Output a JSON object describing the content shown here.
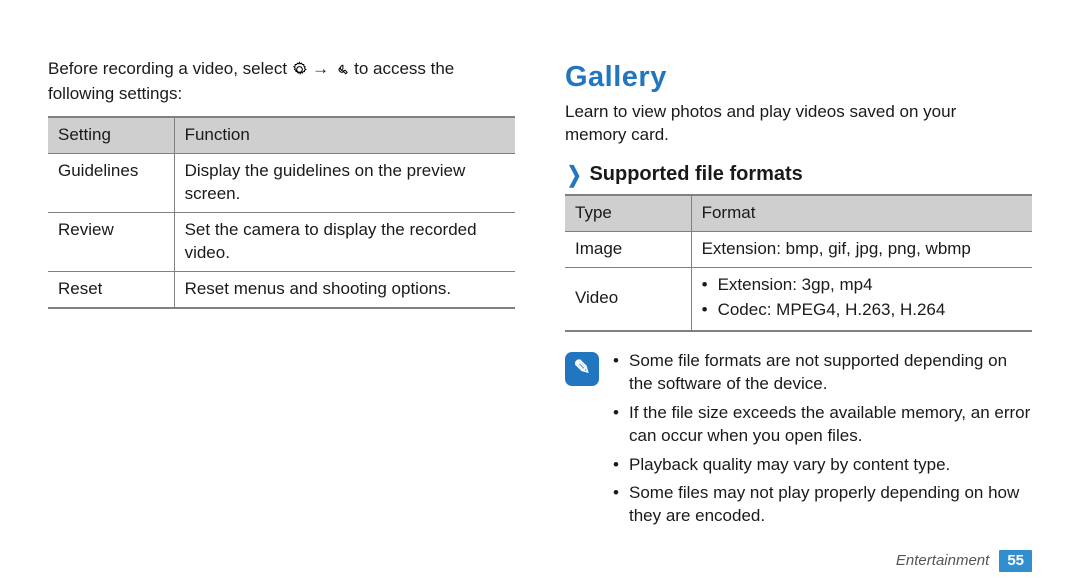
{
  "left": {
    "intro_1a": "Before recording a video, select",
    "intro_1b": "→",
    "intro_1c": "to access the",
    "intro_2": "following settings:",
    "icons": {
      "gear": "settings-gear",
      "wrench": "wrench-icon"
    },
    "table": {
      "head": {
        "c1": "Setting",
        "c2": "Function"
      },
      "rows": [
        {
          "c1": "Guidelines",
          "c2": "Display the guidelines on the preview screen."
        },
        {
          "c1": "Review",
          "c2": "Set the camera to display the recorded video."
        },
        {
          "c1": "Reset",
          "c2": "Reset menus and shooting options."
        }
      ]
    }
  },
  "right": {
    "title": "Gallery",
    "lead1": "Learn to view photos and play videos saved on your",
    "lead2": "memory card.",
    "sub": "Supported file formats",
    "table": {
      "head": {
        "c1": "Type",
        "c2": "Format"
      },
      "image_row": {
        "c1": "Image",
        "c2": "Extension: bmp, gif, jpg, png, wbmp"
      },
      "video_row": {
        "c1": "Video",
        "items": [
          "Extension: 3gp, mp4",
          "Codec: MPEG4, H.263, H.264"
        ]
      }
    },
    "note_icon_glyph": "✎",
    "notes": [
      "Some file formats are not supported depending on the software of the device.",
      "If the file size exceeds the available memory, an error can occur when you open files.",
      "Playback quality may vary by content type.",
      "Some files may not play properly depending on how they are encoded."
    ]
  },
  "footer": {
    "category": "Entertainment",
    "page": "55"
  }
}
